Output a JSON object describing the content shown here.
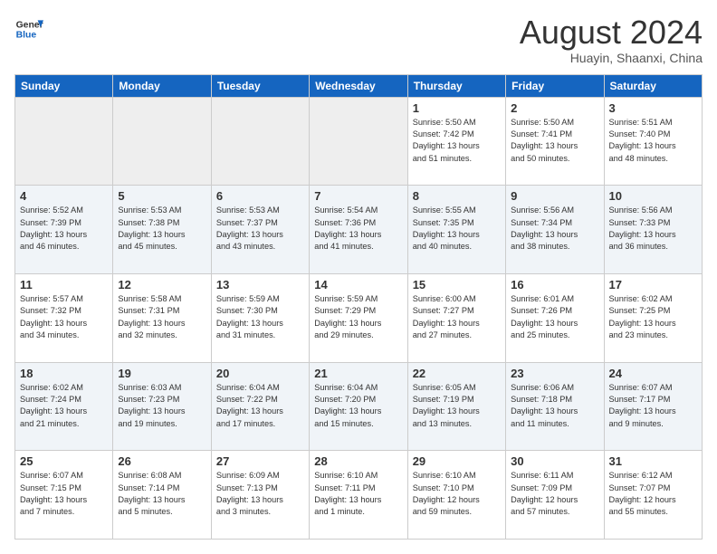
{
  "header": {
    "logo_line1": "General",
    "logo_line2": "Blue",
    "month_year": "August 2024",
    "location": "Huayin, Shaanxi, China"
  },
  "days_of_week": [
    "Sunday",
    "Monday",
    "Tuesday",
    "Wednesday",
    "Thursday",
    "Friday",
    "Saturday"
  ],
  "weeks": [
    [
      {
        "day": "",
        "info": ""
      },
      {
        "day": "",
        "info": ""
      },
      {
        "day": "",
        "info": ""
      },
      {
        "day": "",
        "info": ""
      },
      {
        "day": "1",
        "info": "Sunrise: 5:50 AM\nSunset: 7:42 PM\nDaylight: 13 hours\nand 51 minutes."
      },
      {
        "day": "2",
        "info": "Sunrise: 5:50 AM\nSunset: 7:41 PM\nDaylight: 13 hours\nand 50 minutes."
      },
      {
        "day": "3",
        "info": "Sunrise: 5:51 AM\nSunset: 7:40 PM\nDaylight: 13 hours\nand 48 minutes."
      }
    ],
    [
      {
        "day": "4",
        "info": "Sunrise: 5:52 AM\nSunset: 7:39 PM\nDaylight: 13 hours\nand 46 minutes."
      },
      {
        "day": "5",
        "info": "Sunrise: 5:53 AM\nSunset: 7:38 PM\nDaylight: 13 hours\nand 45 minutes."
      },
      {
        "day": "6",
        "info": "Sunrise: 5:53 AM\nSunset: 7:37 PM\nDaylight: 13 hours\nand 43 minutes."
      },
      {
        "day": "7",
        "info": "Sunrise: 5:54 AM\nSunset: 7:36 PM\nDaylight: 13 hours\nand 41 minutes."
      },
      {
        "day": "8",
        "info": "Sunrise: 5:55 AM\nSunset: 7:35 PM\nDaylight: 13 hours\nand 40 minutes."
      },
      {
        "day": "9",
        "info": "Sunrise: 5:56 AM\nSunset: 7:34 PM\nDaylight: 13 hours\nand 38 minutes."
      },
      {
        "day": "10",
        "info": "Sunrise: 5:56 AM\nSunset: 7:33 PM\nDaylight: 13 hours\nand 36 minutes."
      }
    ],
    [
      {
        "day": "11",
        "info": "Sunrise: 5:57 AM\nSunset: 7:32 PM\nDaylight: 13 hours\nand 34 minutes."
      },
      {
        "day": "12",
        "info": "Sunrise: 5:58 AM\nSunset: 7:31 PM\nDaylight: 13 hours\nand 32 minutes."
      },
      {
        "day": "13",
        "info": "Sunrise: 5:59 AM\nSunset: 7:30 PM\nDaylight: 13 hours\nand 31 minutes."
      },
      {
        "day": "14",
        "info": "Sunrise: 5:59 AM\nSunset: 7:29 PM\nDaylight: 13 hours\nand 29 minutes."
      },
      {
        "day": "15",
        "info": "Sunrise: 6:00 AM\nSunset: 7:27 PM\nDaylight: 13 hours\nand 27 minutes."
      },
      {
        "day": "16",
        "info": "Sunrise: 6:01 AM\nSunset: 7:26 PM\nDaylight: 13 hours\nand 25 minutes."
      },
      {
        "day": "17",
        "info": "Sunrise: 6:02 AM\nSunset: 7:25 PM\nDaylight: 13 hours\nand 23 minutes."
      }
    ],
    [
      {
        "day": "18",
        "info": "Sunrise: 6:02 AM\nSunset: 7:24 PM\nDaylight: 13 hours\nand 21 minutes."
      },
      {
        "day": "19",
        "info": "Sunrise: 6:03 AM\nSunset: 7:23 PM\nDaylight: 13 hours\nand 19 minutes."
      },
      {
        "day": "20",
        "info": "Sunrise: 6:04 AM\nSunset: 7:22 PM\nDaylight: 13 hours\nand 17 minutes."
      },
      {
        "day": "21",
        "info": "Sunrise: 6:04 AM\nSunset: 7:20 PM\nDaylight: 13 hours\nand 15 minutes."
      },
      {
        "day": "22",
        "info": "Sunrise: 6:05 AM\nSunset: 7:19 PM\nDaylight: 13 hours\nand 13 minutes."
      },
      {
        "day": "23",
        "info": "Sunrise: 6:06 AM\nSunset: 7:18 PM\nDaylight: 13 hours\nand 11 minutes."
      },
      {
        "day": "24",
        "info": "Sunrise: 6:07 AM\nSunset: 7:17 PM\nDaylight: 13 hours\nand 9 minutes."
      }
    ],
    [
      {
        "day": "25",
        "info": "Sunrise: 6:07 AM\nSunset: 7:15 PM\nDaylight: 13 hours\nand 7 minutes."
      },
      {
        "day": "26",
        "info": "Sunrise: 6:08 AM\nSunset: 7:14 PM\nDaylight: 13 hours\nand 5 minutes."
      },
      {
        "day": "27",
        "info": "Sunrise: 6:09 AM\nSunset: 7:13 PM\nDaylight: 13 hours\nand 3 minutes."
      },
      {
        "day": "28",
        "info": "Sunrise: 6:10 AM\nSunset: 7:11 PM\nDaylight: 13 hours\nand 1 minute."
      },
      {
        "day": "29",
        "info": "Sunrise: 6:10 AM\nSunset: 7:10 PM\nDaylight: 12 hours\nand 59 minutes."
      },
      {
        "day": "30",
        "info": "Sunrise: 6:11 AM\nSunset: 7:09 PM\nDaylight: 12 hours\nand 57 minutes."
      },
      {
        "day": "31",
        "info": "Sunrise: 6:12 AM\nSunset: 7:07 PM\nDaylight: 12 hours\nand 55 minutes."
      }
    ]
  ]
}
